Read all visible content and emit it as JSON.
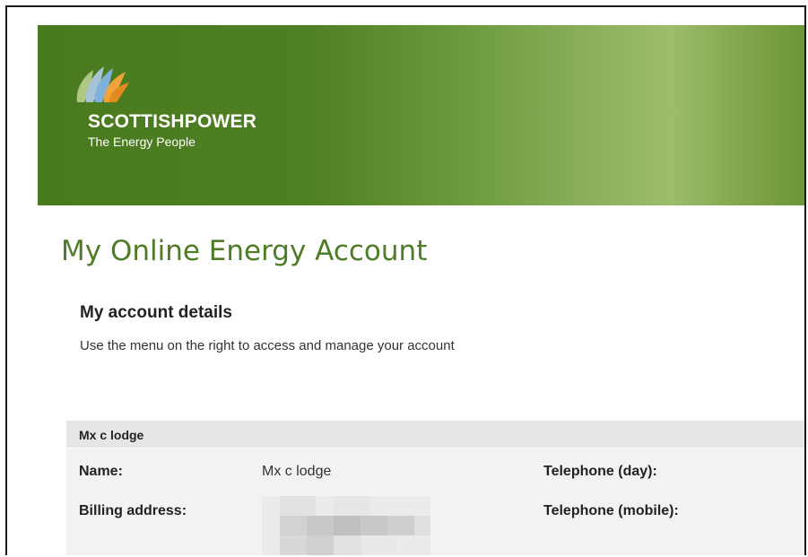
{
  "brand": {
    "name": "SCOTTISHPOWER",
    "tagline": "The Energy People",
    "colors": {
      "banner": "#4a7a1e",
      "title_green": "#4f7c26"
    }
  },
  "page": {
    "title": "My Online Energy Account"
  },
  "section": {
    "heading": "My account details",
    "description": "Use the menu on the right to access and manage your account"
  },
  "account": {
    "header": "Mx c lodge",
    "fields": [
      {
        "label": "Name:",
        "value": "Mx c lodge"
      },
      {
        "label": "Billing address:",
        "value": ""
      },
      {
        "label": "Telephone (day):",
        "value": ""
      },
      {
        "label": "Telephone (mobile):",
        "value": ""
      }
    ]
  }
}
